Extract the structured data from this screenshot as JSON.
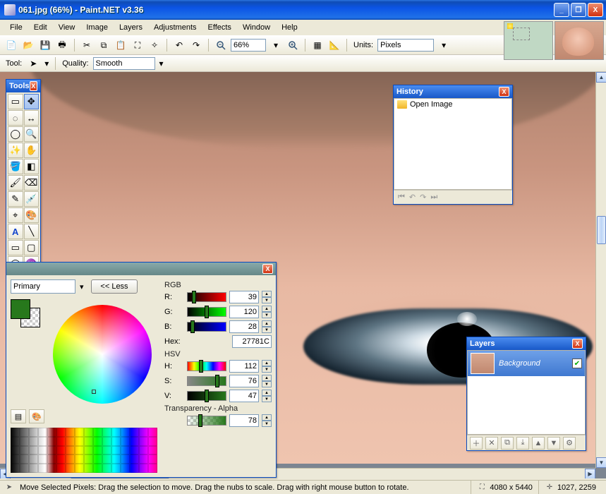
{
  "window": {
    "title": "061.jpg (66%) - Paint.NET v3.36"
  },
  "menu": {
    "items": [
      "File",
      "Edit",
      "View",
      "Image",
      "Layers",
      "Adjustments",
      "Effects",
      "Window",
      "Help"
    ]
  },
  "toolbar": {
    "zoom": "66%",
    "units_label": "Units:",
    "units_value": "Pixels",
    "tool_label": "Tool:",
    "quality_label": "Quality:",
    "quality_value": "Smooth"
  },
  "tools_pane": {
    "title": "Tools"
  },
  "history_pane": {
    "title": "History",
    "items": [
      "Open Image"
    ]
  },
  "colors_pane": {
    "primary_label": "Primary",
    "less_label": "<< Less",
    "rgb_label": "RGB",
    "r_label": "R:",
    "r": 39,
    "g_label": "G:",
    "g": 120,
    "b_label": "B:",
    "b": 28,
    "hex_label": "Hex:",
    "hex": "27781C",
    "hsv_label": "HSV",
    "h_label": "H:",
    "h": 112,
    "s_label": "S:",
    "s": 76,
    "v_label": "V:",
    "v": 47,
    "alpha_label": "Transparency - Alpha",
    "alpha": 78
  },
  "layers_pane": {
    "title": "Layers",
    "layer0": "Background"
  },
  "status": {
    "hint": "Move Selected Pixels: Drag the selection to move. Drag the nubs to scale. Drag with right mouse button to rotate.",
    "dims": "4080 x 5440",
    "cursor": "1027, 2259"
  }
}
